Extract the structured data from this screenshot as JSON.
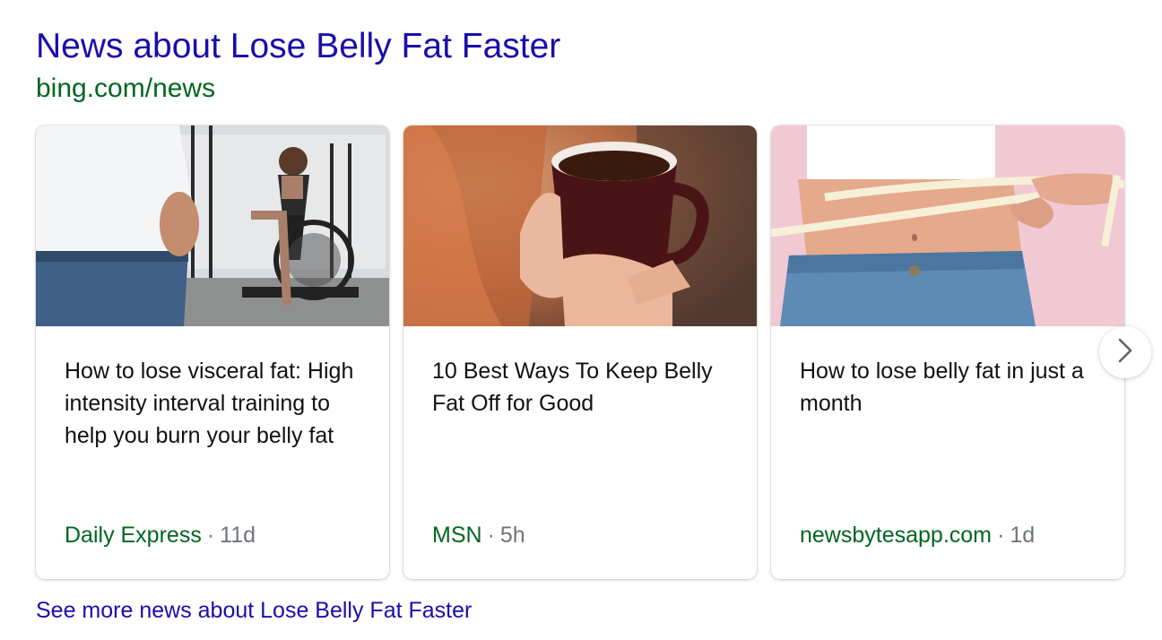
{
  "section": {
    "title": "News about Lose Belly Fat Faster",
    "url": "bing.com/news"
  },
  "cards": [
    {
      "headline": "How to lose visceral fat: High intensity interval training to help you burn your belly fat",
      "source": "Daily Express",
      "separator": "·",
      "age": "11d"
    },
    {
      "headline": "10 Best Ways To Keep Belly Fat Off for Good",
      "source": "MSN",
      "separator": "·",
      "age": "5h"
    },
    {
      "headline": "How to lose belly fat in just a month",
      "source": "newsbytesapp.com",
      "separator": "·",
      "age": "1d"
    }
  ],
  "next_button": {
    "icon": "chevron-right-icon"
  },
  "see_more": {
    "label": "See more news about Lose Belly Fat Faster"
  },
  "colors": {
    "title": "#1a0dab",
    "url": "#006621",
    "source": "#006621",
    "meta": "#70757a",
    "headline": "#111111"
  }
}
